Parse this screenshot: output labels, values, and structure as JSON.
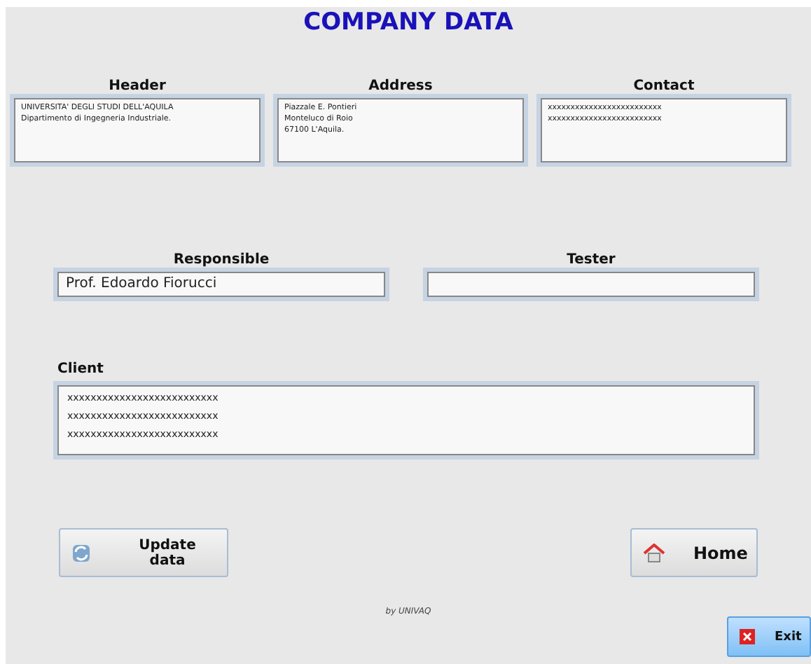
{
  "title": "COMPANY DATA",
  "top_fields": [
    {
      "label": "Header",
      "value": "UNIVERSITA' DEGLI STUDI DELL'AQUILA\nDipartimento di Ingegneria Industriale."
    },
    {
      "label": "Address",
      "value": "Piazzale E. Pontieri\nMonteluco di Roio\n67100 L'Aquila."
    },
    {
      "label": "Contact",
      "value": "xxxxxxxxxxxxxxxxxxxxxxxxx\nxxxxxxxxxxxxxxxxxxxxxxxxx"
    }
  ],
  "people_fields": [
    {
      "label": "Responsible",
      "value": "Prof. Edoardo Fiorucci"
    },
    {
      "label": "Tester"
    }
  ],
  "client": {
    "label": "Client",
    "value": "xxxxxxxxxxxxxxxxxxxxxxxxxx\nxxxxxxxxxxxxxxxxxxxxxxxxxx\nxxxxxxxxxxxxxxxxxxxxxxxxxx"
  },
  "buttons": [
    {
      "kind": "update",
      "label": "Update data"
    },
    {
      "kind": "home",
      "label": "Home"
    }
  ],
  "footer": "by UNIVAQ",
  "exit_button": {
    "label": "Exit"
  }
}
